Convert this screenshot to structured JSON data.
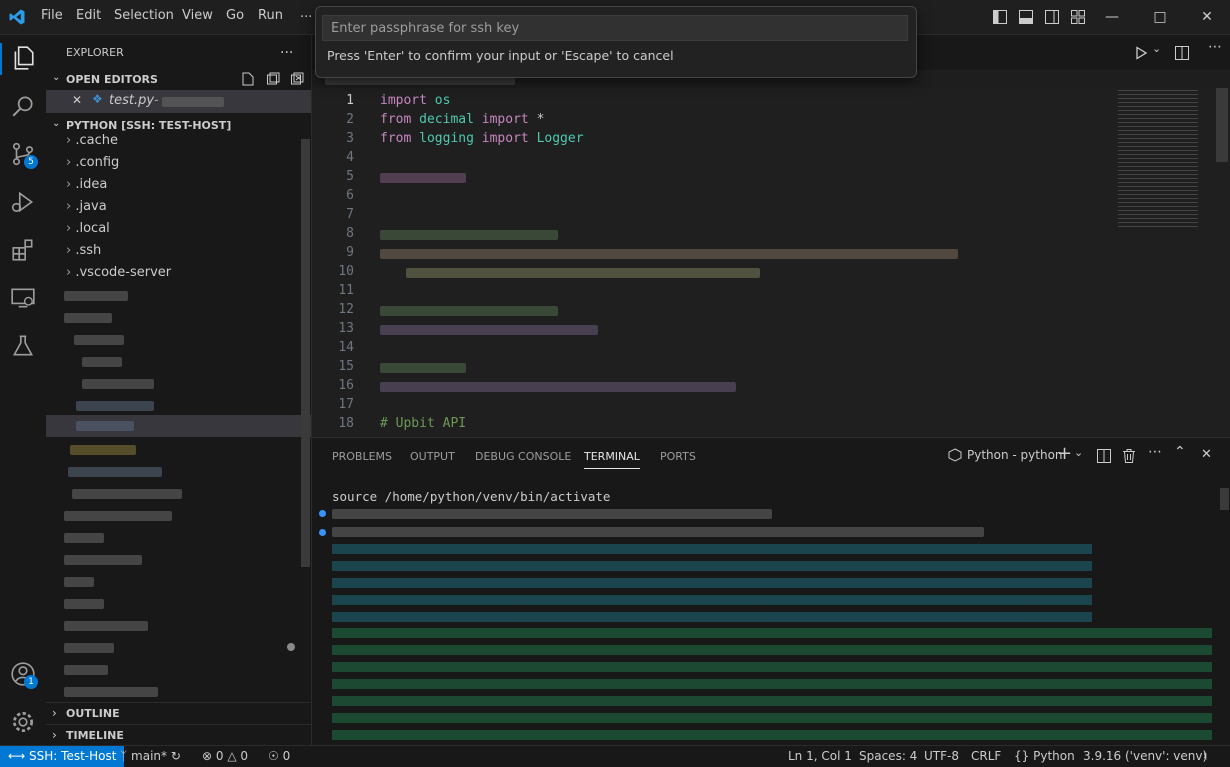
{
  "menu": [
    "File",
    "Edit",
    "Selection",
    "View",
    "Go",
    "Run",
    "..."
  ],
  "quick_input": {
    "placeholder": "Enter passphrase for ssh key",
    "message": "Press 'Enter' to confirm your input or 'Escape' to cancel"
  },
  "sidebar": {
    "title": "EXPLORER",
    "more": "...",
    "open_editors_label": "OPEN EDITORS",
    "open_editor_file": "test.py",
    "open_editor_suffix": "-",
    "folder_label": "PYTHON [SSH: TEST-HOST]",
    "folders": [
      ".cache",
      ".config",
      ".idea",
      ".java",
      ".local",
      ".ssh",
      ".vscode-server"
    ],
    "outline_label": "OUTLINE",
    "timeline_label": "TIMELINE"
  },
  "badges": {
    "source_control": "5",
    "accounts": "1"
  },
  "editor": {
    "line_numbers": [
      "1",
      "2",
      "3",
      "4",
      "5",
      "6",
      "7",
      "8",
      "9",
      "10",
      "11",
      "12",
      "13",
      "14",
      "15",
      "16",
      "17",
      "18"
    ],
    "line1": {
      "kw": "import",
      "mod": "os"
    },
    "line2": {
      "kw1": "from",
      "mod": "decimal",
      "kw2": "import",
      "rest": "*"
    },
    "line3": {
      "kw1": "from",
      "mod": "logging",
      "kw2": "import",
      "rest": "Logger"
    },
    "line18": "# Upbit API"
  },
  "panel": {
    "tabs": [
      "PROBLEMS",
      "OUTPUT",
      "DEBUG CONSOLE",
      "TERMINAL",
      "PORTS"
    ],
    "terminal_name": "Python - python",
    "first_line": "source /home/python/venv/bin/activate"
  },
  "statusbar": {
    "remote": "SSH: Test-Host",
    "branch": "main*",
    "errors": "0",
    "warnings": "0",
    "ports": "0",
    "position": "Ln 1, Col 1",
    "spaces": "Spaces: 4",
    "encoding": "UTF-8",
    "eol": "CRLF",
    "language": "Python",
    "interpreter": "3.9.16 ('venv': venv)"
  },
  "colors": {
    "accent": "#0078d4",
    "keyword": "#c586c0",
    "module": "#4ec9b0",
    "comment": "#6a9955"
  }
}
